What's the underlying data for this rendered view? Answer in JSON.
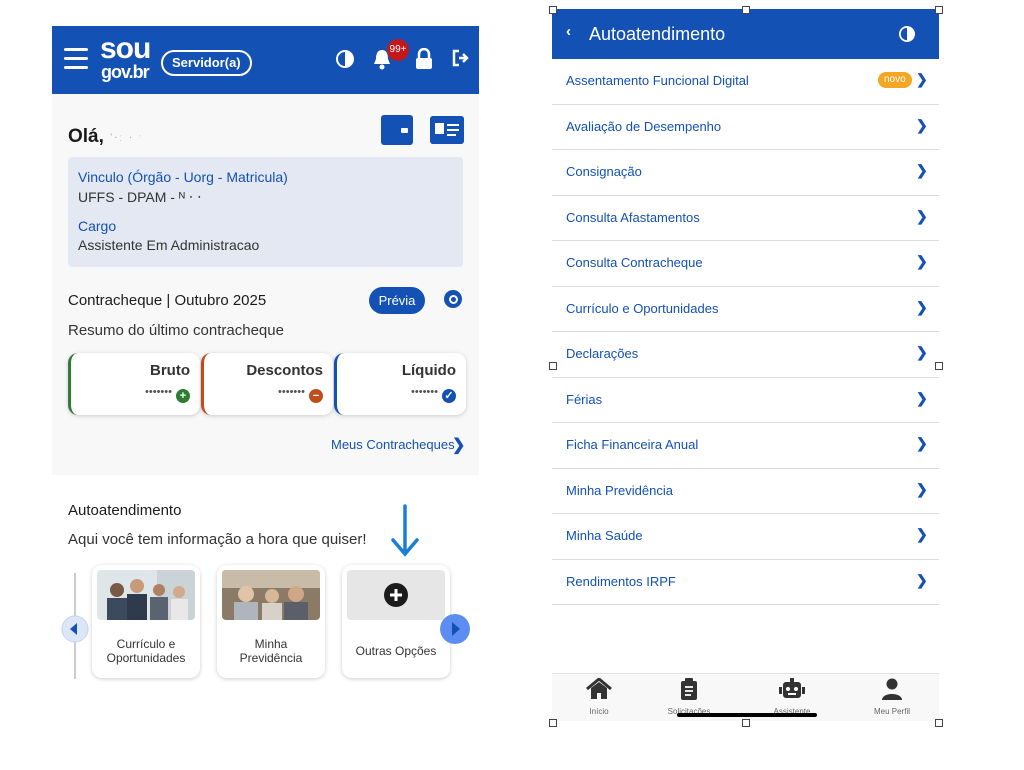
{
  "left": {
    "header": {
      "logo_sou": "sou",
      "logo_gov": "gov.br",
      "role_badge": "Servidor(a)",
      "notifications_count": "99+",
      "icons": [
        "menu-icon",
        "contrast-icon",
        "bell-icon",
        "lock-icon",
        "logout-icon"
      ]
    },
    "greeting": "Olá,",
    "greeting_name_masked": "ʼ‧ː ‧ ˑ",
    "vinculo": {
      "label": "Vinculo (Órgão - Uorg - Matricula)",
      "value": "UFFS - DPAM - ᴺ ‧ ‧",
      "cargo_label": "Cargo",
      "cargo_value": "Assistente Em Administracao"
    },
    "contracheque": {
      "title": "Contracheque | Outubro 2025",
      "previa": "Prévia",
      "subtitle": "Resumo do último contracheque",
      "cards": [
        {
          "label": "Bruto",
          "value": "•••••••",
          "color": "#2e7d32",
          "sign": "+"
        },
        {
          "label": "Descontos",
          "value": "•••••••",
          "color": "#bf4e1e",
          "sign": "−"
        },
        {
          "label": "Líquido",
          "value": "•••••••",
          "color": "#1351b4",
          "sign": "✓"
        }
      ],
      "link": "Meus Contracheques",
      "link_chevron": "❯"
    },
    "autoatendimento": {
      "title": "Autoatendimento",
      "subtitle": "Aqui você tem informação a hora que quiser!",
      "options": [
        {
          "line1": "Currículo e",
          "line2": "Oportunidades"
        },
        {
          "line1": "Minha",
          "line2": "Previdência"
        },
        {
          "line1": "Outras Opções",
          "line2": ""
        }
      ]
    }
  },
  "right": {
    "header": {
      "back": "‹",
      "title": "Autoatendimento"
    },
    "menu": [
      {
        "label": "Assentamento Funcional Digital",
        "badge": "novo"
      },
      {
        "label": "Avaliação de Desempenho"
      },
      {
        "label": "Consignação"
      },
      {
        "label": "Consulta Afastamentos"
      },
      {
        "label": "Consulta Contracheque"
      },
      {
        "label": "Currículo e Oportunidades"
      },
      {
        "label": "Declarações"
      },
      {
        "label": "Férias"
      },
      {
        "label": "Ficha Financeira Anual"
      },
      {
        "label": "Minha Previdência"
      },
      {
        "label": "Minha Saúde"
      },
      {
        "label": "Rendimentos IRPF"
      }
    ],
    "chevron": "❯",
    "tabs": [
      {
        "label": "Início",
        "icon": "home-icon"
      },
      {
        "label": "Solicitações",
        "icon": "clipboard-icon"
      },
      {
        "label": "Assistente",
        "icon": "robot-icon"
      },
      {
        "label": "Meu Perfil",
        "icon": "user-icon"
      }
    ]
  },
  "colors": {
    "brand_blue": "#1351b4",
    "panel_gray": "#e3e8f2",
    "badge_orange": "#f5a623",
    "alert_red": "#c4171c"
  }
}
